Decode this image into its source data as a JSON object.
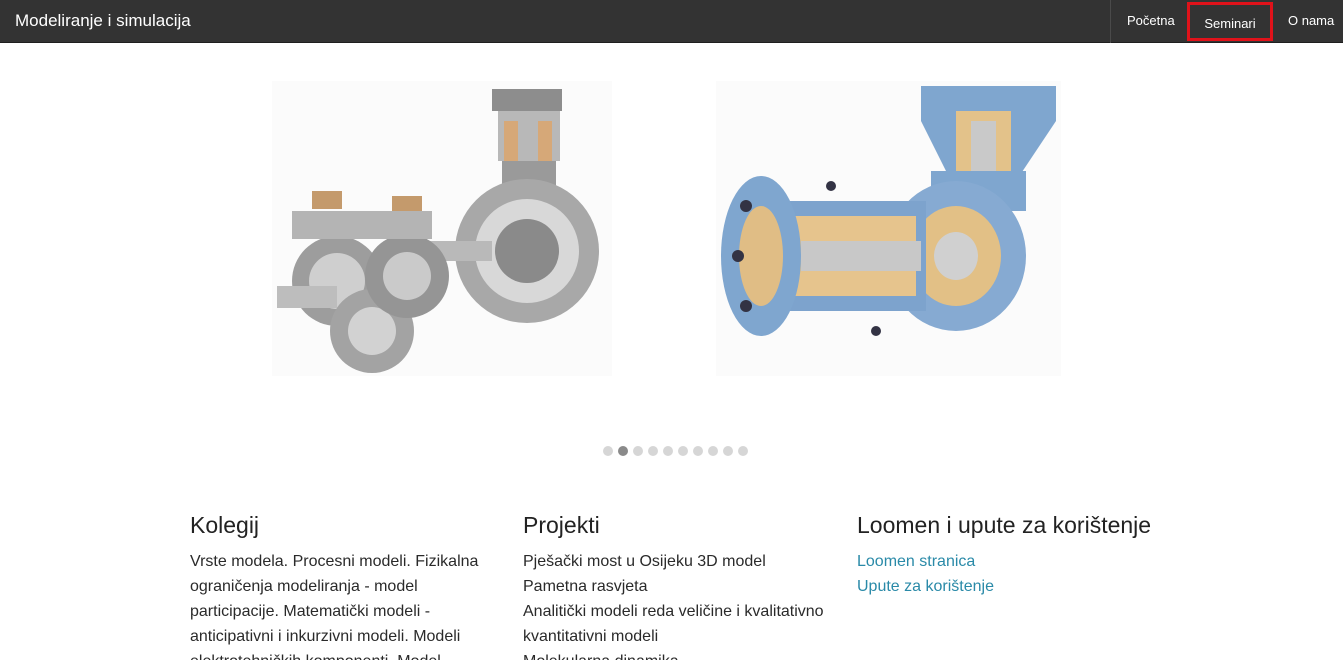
{
  "navbar": {
    "brand": "Modeliranje i simulacija",
    "items": [
      {
        "label": "Početna"
      },
      {
        "label": "Seminari"
      },
      {
        "label": "O nama"
      }
    ]
  },
  "carousel": {
    "dot_count": 10,
    "active_index": 1
  },
  "sections": [
    {
      "heading": "Kolegij",
      "text": "Vrste modela. Procesni modeli. Fizikalna ograničenja modeliranja - model participacije. Matematički modeli - anticipativni i inkurzivni modeli. Modeli elektrotehničkih komponenti. Model"
    },
    {
      "heading": "Projekti",
      "items": [
        "Pješački most u Osijeku 3D model",
        "Pametna rasvjeta",
        "Analitički modeli reda veličine i kvalitativno",
        "kvantitativni modeli",
        "Molekularna dinamika"
      ]
    },
    {
      "heading": "Loomen i upute za korištenje",
      "links": [
        "Loomen stranica",
        "Upute za korištenje"
      ]
    }
  ],
  "colors": {
    "navbar_bg": "#333333",
    "highlight": "#e0121a",
    "link": "#2a8aa8"
  }
}
